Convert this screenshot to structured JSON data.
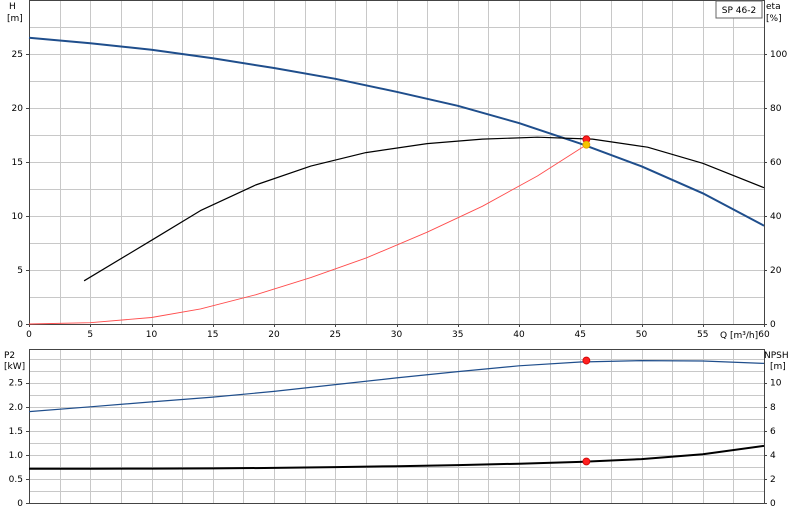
{
  "chart_data": [
    {
      "type": "line",
      "title": "",
      "xlabel": "Q [m³/h]",
      "xlim": [
        0,
        60
      ],
      "x_ticks": [
        0,
        5,
        10,
        15,
        20,
        25,
        30,
        35,
        40,
        45,
        50,
        55,
        60
      ],
      "ylabel_left": {
        "name": "H",
        "unit": "[m]"
      },
      "ylim_left": [
        0,
        30
      ],
      "y_ticks_left": [
        0,
        5,
        10,
        15,
        20,
        25
      ],
      "ylabel_right": {
        "name": "eta",
        "unit": "[%]"
      },
      "ylim_right": [
        0,
        120
      ],
      "y_ticks_right": [
        0,
        20,
        40,
        60,
        80,
        100
      ],
      "grid": true,
      "legend_box": "SP 46-2",
      "series": [
        {
          "axis": "left",
          "color": "#1f4e8c",
          "x": [
            0,
            5,
            10,
            15,
            20,
            25,
            30,
            35,
            40,
            45,
            50,
            55,
            60
          ],
          "y": [
            26.5,
            26.0,
            25.4,
            24.6,
            23.7,
            22.7,
            21.5,
            20.2,
            18.6,
            16.7,
            14.6,
            12.1,
            9.1
          ]
        },
        {
          "axis": "right",
          "color": "#000000",
          "x": [
            4.5,
            10,
            14,
            18.5,
            23,
            27.5,
            32.5,
            37,
            41.5,
            46,
            50.5,
            55,
            60
          ],
          "y": [
            16,
            31,
            42,
            51.5,
            58.5,
            63.5,
            66.8,
            68.5,
            69.2,
            68.5,
            65.5,
            59.5,
            50.5
          ]
        },
        {
          "axis": "left",
          "color": "#ff4d4d",
          "x": [
            0,
            5,
            10,
            14,
            18.5,
            23,
            27.5,
            32.5,
            37,
            41.5,
            45.5
          ],
          "y": [
            0,
            0.12,
            0.6,
            1.4,
            2.7,
            4.3,
            6.1,
            8.5,
            10.9,
            13.7,
            16.6
          ]
        }
      ],
      "markers": [
        {
          "x": 45.5,
          "y": 17.1,
          "axis": "left",
          "color": "#ff2020"
        },
        {
          "x": 45.5,
          "y": 16.6,
          "axis": "left",
          "color": "#f5c400"
        }
      ]
    },
    {
      "type": "line",
      "title": "",
      "xlabel": "",
      "xlim": [
        0,
        60
      ],
      "ylabel_left": {
        "name": "P2",
        "unit": "[kW]"
      },
      "ylim_left": [
        0,
        3.2
      ],
      "y_ticks_left": [
        "0",
        "0.5",
        "1.0",
        "1.5",
        "2.0",
        "2.5"
      ],
      "ylabel_right": {
        "name": "NPSH",
        "unit": "[m]"
      },
      "ylim_right": [
        0,
        12.8
      ],
      "y_ticks_right": [
        "0",
        "2",
        "4",
        "6",
        "8",
        "10"
      ],
      "grid": true,
      "series": [
        {
          "axis": "left",
          "color": "#1f4e8c",
          "x": [
            0,
            5,
            10,
            15,
            20,
            25,
            30,
            35,
            40,
            45,
            50,
            55,
            60
          ],
          "y": [
            1.9,
            2.0,
            2.1,
            2.2,
            2.32,
            2.46,
            2.6,
            2.73,
            2.85,
            2.93,
            2.96,
            2.95,
            2.9
          ]
        },
        {
          "axis": "right",
          "color": "#000000",
          "x": [
            0,
            5,
            10,
            15,
            20,
            25,
            30,
            35,
            40,
            45,
            50,
            55,
            60
          ],
          "y": [
            2.85,
            2.85,
            2.86,
            2.88,
            2.92,
            2.98,
            3.06,
            3.15,
            3.27,
            3.42,
            3.65,
            4.05,
            4.75
          ]
        }
      ],
      "markers": [
        {
          "x": 45.5,
          "y": 2.96,
          "axis": "left",
          "color": "#ff2020"
        },
        {
          "x": 45.5,
          "y": 3.45,
          "axis": "right",
          "color": "#ff2020"
        }
      ]
    }
  ]
}
